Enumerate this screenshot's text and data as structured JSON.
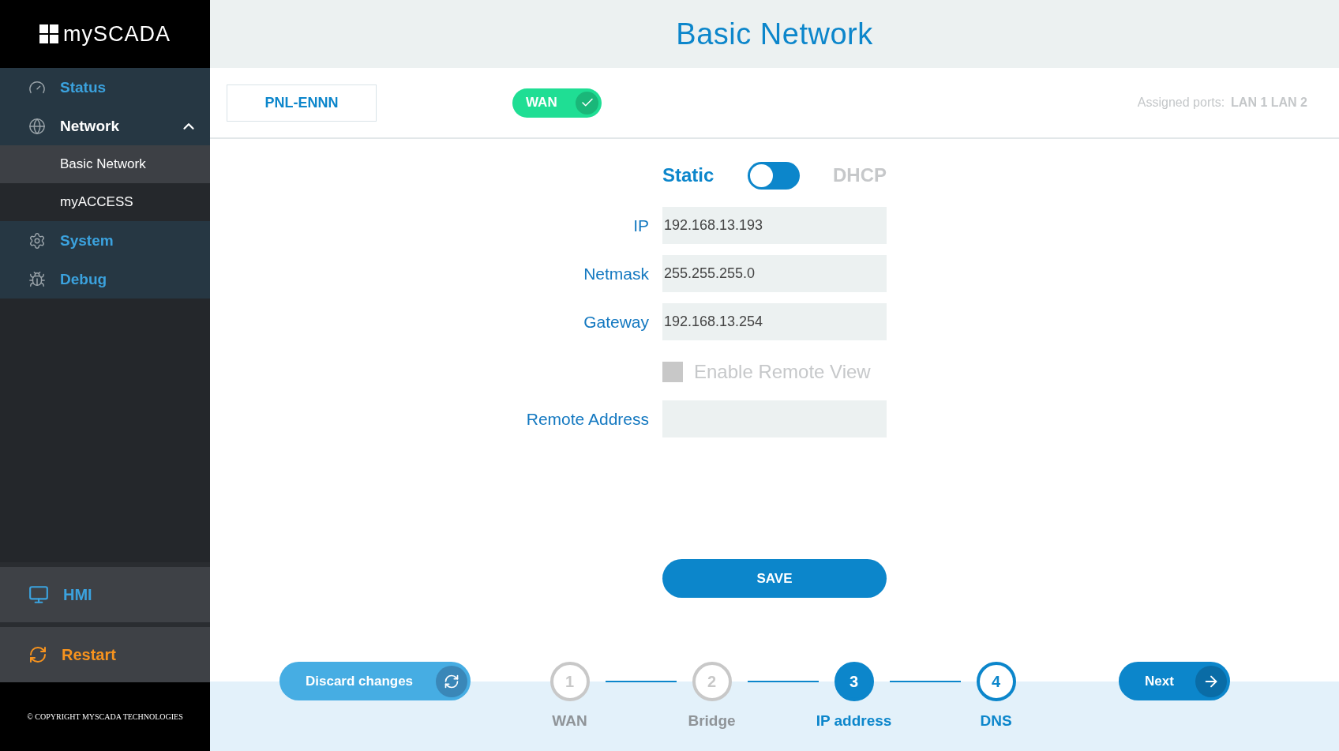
{
  "sidebar": {
    "logo": "mySCADA",
    "items": [
      {
        "label": "Status",
        "kind": "status",
        "expanded": false
      },
      {
        "label": "Network",
        "kind": "network",
        "expanded": true,
        "children": [
          {
            "label": "Basic Network",
            "selected": true
          },
          {
            "label": "myACCESS",
            "selected": false
          }
        ]
      },
      {
        "label": "System",
        "kind": "system",
        "expanded": false
      },
      {
        "label": "Debug",
        "kind": "debug",
        "expanded": false
      }
    ],
    "hmi": "HMI",
    "restart": "Restart",
    "copyright": "© COPYRIGHT MYSCADA TECHNOLOGIES"
  },
  "page_title": "Basic Network",
  "interface": {
    "name": "PNL-ENNN",
    "wan_label": "WAN",
    "wan_on": true,
    "ports_label": "Assigned ports:",
    "ports": "LAN 1 LAN 2"
  },
  "mode": {
    "static_label": "Static",
    "dhcp_label": "DHCP",
    "dhcp": false
  },
  "fields": [
    {
      "label": "IP",
      "value": "192.168.13.193"
    },
    {
      "label": "Netmask",
      "value": "255.255.255.0"
    },
    {
      "label": "Gateway",
      "value": "192.168.13.254"
    }
  ],
  "remote_view": {
    "label": "Enable Remote View",
    "checked": false
  },
  "remote_address": {
    "label": "Remote Address"
  },
  "save": "SAVE",
  "discard": "Discard changes",
  "next": "Next",
  "steps": [
    {
      "number": "1",
      "label": "WAN",
      "kind": "done"
    },
    {
      "number": "2",
      "label": "Bridge",
      "kind": "done"
    },
    {
      "number": "3",
      "label": "IP address",
      "kind": "current"
    },
    {
      "number": "4",
      "label": "DNS",
      "kind": "upcoming"
    }
  ]
}
